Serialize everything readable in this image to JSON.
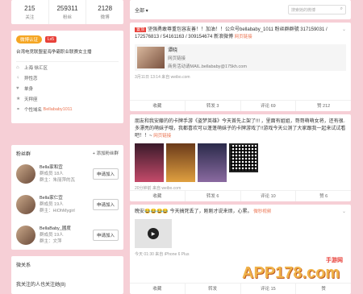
{
  "stats": [
    {
      "value": "215",
      "label": "关注"
    },
    {
      "value": "259311",
      "label": "粉丝"
    },
    {
      "value": "2128",
      "label": "微博"
    }
  ],
  "profile": {
    "verify_badge": "微博认证",
    "level_badge": "Lv5",
    "bio": "台湾电竞联盟星海争霸职业联赛女主播",
    "info": [
      {
        "icon": "location-icon",
        "glyph": "⌂",
        "text": "上海 徐汇区"
      },
      {
        "icon": "gender-icon",
        "glyph": "♀",
        "text": "异性恋"
      },
      {
        "icon": "heart-icon",
        "glyph": "♥",
        "text": "单身"
      },
      {
        "icon": "star-icon",
        "glyph": "★",
        "text": "天秤座"
      },
      {
        "icon": "link-icon",
        "glyph": "⚭",
        "prefix": "个性域名",
        "text": "Bellababy1011"
      }
    ]
  },
  "fan_groups": {
    "title": "粉丝群",
    "add_label": "+ 添加粉丝群",
    "join_label": "申请加入",
    "groups": [
      {
        "name": "Bella家和宜",
        "members": "群成员 18人",
        "owner": "群主：朱丽萍的瓦"
      },
      {
        "name": "Bella家仁宜",
        "members": "群成员 19人",
        "owner": "群主：HiOhMygirl"
      },
      {
        "name": "BellaBaby_國度",
        "members": "群成员 19人",
        "owner": "群主：文萍"
      }
    ]
  },
  "micro": {
    "title": "微关系",
    "subtitle": "我关注的人也关注她(8)"
  },
  "topbar": {
    "filter": "全部 ▾",
    "search_placeholder": "搜索她的微博"
  },
  "posts": [
    {
      "top_tag": "置顶",
      "text": "坚强勇敢尊重包容友善！！加油！！公众号bellababy_1011 粉丝群群號 317159031 / 172576813 / 54161163 / 309154674 新浪微博",
      "link": "网页链接",
      "card_title": "谭晓",
      "card_link": "网页链接",
      "card_desc": "商务活动请MAIL.bellababy@175kh.com",
      "meta": "3月11日 13:14 来自 weibo.com",
      "actions": [
        "收藏",
        "转发 3",
        "评论 69",
        "赞 212"
      ]
    },
    {
      "text": "朋友和我安藤的的卡牌手游《盗梦英雄》今天首先上架了!!! ，里面有姐姐，哥哥萌萌女将，还有很多漂亮的萌妹子哦，我都喜欢可以蓬蓬萌妹子的卡牌游戏了!!游戏今天公测了大家跟我一起来试试看吧！！~",
      "link": "网页链接",
      "meta": "20分钟前 来自 weibo.com",
      "actions": [
        "收藏",
        "转发 6",
        "评论 10",
        "赞 6"
      ]
    },
    {
      "text": "晚安😂😂😂😂 今天搞死丢了，刚刚才说来烦，心累。",
      "link": "微秒视频",
      "meta": "今天 01:30 来自 iPhone 6 Plus",
      "actions": [
        "收藏",
        "转发",
        "评论 15",
        "赞"
      ]
    }
  ],
  "watermark": {
    "main": "APP178.com",
    "small": "手游网"
  }
}
